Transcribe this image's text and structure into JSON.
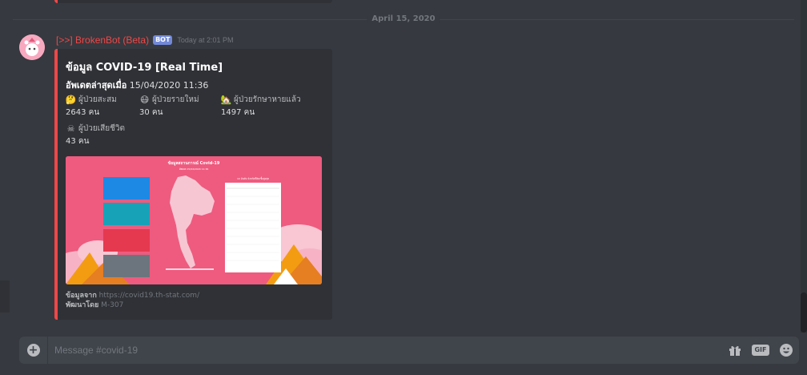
{
  "date_divider": "April 15, 2020",
  "message": {
    "username": "[>>] BrokenBot (Beta)",
    "bot_tag": "BOT",
    "timestamp": "Today at 2:01 PM"
  },
  "embed": {
    "title": "ข้อมูล COVID-19 [Real Time]",
    "updated_label": "อัพเดตล่าสุดเมื่อ",
    "updated_value": "15/04/2020 11:36",
    "fields": [
      {
        "icon": "confused-face-icon",
        "emoji": "🤔",
        "name": "ผู้ป่วยสะสม",
        "value": "2643 คน"
      },
      {
        "icon": "mask-face-icon",
        "emoji": "😷",
        "name": "ผู้ป่วยรายใหม่",
        "value": "30 คน"
      },
      {
        "icon": "house-icon",
        "emoji": "🏡",
        "name": "ผู้ป่วยรักษาหายแล้ว",
        "value": "1497 คน"
      },
      {
        "icon": "skull-icon",
        "emoji": "☠",
        "name": "ผู้ป่วยเสียชีวิต",
        "value": "43 คน"
      }
    ],
    "image": {
      "title": "ข้อมูลสถานการณ์ Covid-19",
      "subtitle": "อัพเดต 15/04/2020 11:36",
      "table_title": "10 อันดับ จังหวัดที่ติดเชื้อสูงสุด",
      "cards_color": [
        "#1e88e5",
        "#17a2b8",
        "#e53950",
        "#6c757d"
      ],
      "background": "#ee5b7f"
    },
    "footer_label_1": "ข้อมูลจาก",
    "footer_value_1": "https://covid19.th-stat.com/",
    "footer_label_2": "พัฒนาโดย",
    "footer_value_2": "M-307"
  },
  "composer": {
    "placeholder": "Message #covid-19"
  },
  "colors": {
    "accent_red": "#f04747",
    "bot_tag": "#7289da"
  }
}
